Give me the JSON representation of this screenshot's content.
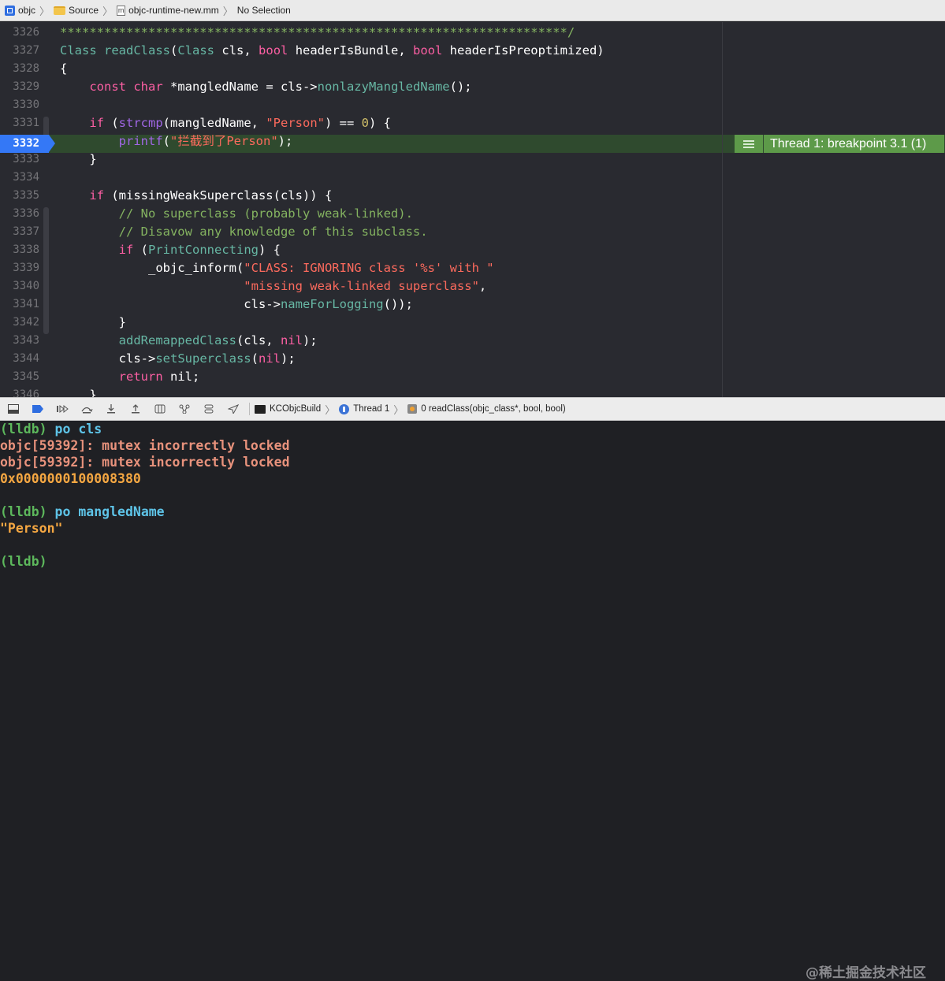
{
  "jumpbar": {
    "project": "objc",
    "folder": "Source",
    "file": "objc-runtime-new.mm",
    "selection": "No Selection",
    "file_icon_letter": "m"
  },
  "editor": {
    "lines": [
      {
        "num": "3326",
        "parts": [
          [
            "cmtg",
            "*********************************************************************/"
          ]
        ]
      },
      {
        "num": "3327",
        "parts": [
          [
            "ty2",
            "Class"
          ],
          [
            "",
            " "
          ],
          [
            "fn",
            "readClass"
          ],
          [
            "",
            "("
          ],
          [
            "ty2",
            "Class"
          ],
          [
            "",
            " cls, "
          ],
          [
            "kw",
            "bool"
          ],
          [
            "",
            " headerIsBundle, "
          ],
          [
            "kw",
            "bool"
          ],
          [
            "",
            " headerIsPreoptimized)"
          ]
        ]
      },
      {
        "num": "3328",
        "parts": [
          [
            "",
            "{"
          ]
        ]
      },
      {
        "num": "3329",
        "parts": [
          [
            "",
            "    "
          ],
          [
            "kw",
            "const"
          ],
          [
            "",
            " "
          ],
          [
            "kw",
            "char"
          ],
          [
            "",
            " *mangledName = cls->"
          ],
          [
            "fn",
            "nonlazyMangledName"
          ],
          [
            "",
            "();"
          ]
        ]
      },
      {
        "num": "3330",
        "parts": [
          [
            "",
            ""
          ]
        ]
      },
      {
        "num": "3331",
        "parts": [
          [
            "",
            "    "
          ],
          [
            "kw",
            "if"
          ],
          [
            "",
            " ("
          ],
          [
            "fnc",
            "strcmp"
          ],
          [
            "",
            "(mangledName, "
          ],
          [
            "str",
            "\"Person\""
          ],
          [
            "",
            ") == "
          ],
          [
            "num",
            "0"
          ],
          [
            "",
            ") {"
          ]
        ]
      },
      {
        "num": "3332",
        "parts": [
          [
            "",
            "        "
          ],
          [
            "fnc",
            "printf"
          ],
          [
            "",
            "("
          ],
          [
            "str",
            "\"拦截到了Person\""
          ],
          [
            "",
            ");"
          ]
        ]
      },
      {
        "num": "3333",
        "parts": [
          [
            "",
            "    }"
          ]
        ]
      },
      {
        "num": "3334",
        "parts": [
          [
            "",
            ""
          ]
        ]
      },
      {
        "num": "3335",
        "parts": [
          [
            "",
            "    "
          ],
          [
            "kw",
            "if"
          ],
          [
            "",
            " (missingWeakSuperclass(cls)) {"
          ]
        ]
      },
      {
        "num": "3336",
        "parts": [
          [
            "",
            "        "
          ],
          [
            "cmtg",
            "// No superclass (probably weak-linked)."
          ]
        ]
      },
      {
        "num": "3337",
        "parts": [
          [
            "",
            "        "
          ],
          [
            "cmtg",
            "// Disavow any knowledge of this subclass."
          ]
        ]
      },
      {
        "num": "3338",
        "parts": [
          [
            "",
            "        "
          ],
          [
            "kw",
            "if"
          ],
          [
            "",
            " ("
          ],
          [
            "fn",
            "PrintConnecting"
          ],
          [
            "",
            ") {"
          ]
        ]
      },
      {
        "num": "3339",
        "parts": [
          [
            "",
            "            _objc_inform("
          ],
          [
            "str",
            "\"CLASS: IGNORING class '%s' with \""
          ]
        ]
      },
      {
        "num": "3340",
        "parts": [
          [
            "",
            "                         "
          ],
          [
            "str",
            "\"missing weak-linked superclass\""
          ],
          [
            "",
            ","
          ]
        ]
      },
      {
        "num": "3341",
        "parts": [
          [
            "",
            "                         cls->"
          ],
          [
            "fn",
            "nameForLogging"
          ],
          [
            "",
            "());"
          ]
        ]
      },
      {
        "num": "3342",
        "parts": [
          [
            "",
            "        }"
          ]
        ]
      },
      {
        "num": "3343",
        "parts": [
          [
            "",
            "        "
          ],
          [
            "fn",
            "addRemappedClass"
          ],
          [
            "",
            "(cls, "
          ],
          [
            "kw",
            "nil"
          ],
          [
            "",
            ");"
          ]
        ]
      },
      {
        "num": "3344",
        "parts": [
          [
            "",
            "        cls->"
          ],
          [
            "fn",
            "setSuperclass"
          ],
          [
            "",
            "("
          ],
          [
            "kw",
            "nil"
          ],
          [
            "",
            ");"
          ]
        ]
      },
      {
        "num": "3345",
        "parts": [
          [
            "",
            "        "
          ],
          [
            "kw",
            "return"
          ],
          [
            "",
            " nil;"
          ]
        ]
      },
      {
        "num": "3346",
        "parts": [
          [
            "",
            "    }"
          ]
        ]
      }
    ],
    "breakpoint_line": "3332",
    "thread_badge": "Thread 1: breakpoint 3.1 (1)"
  },
  "debugbar": {
    "target": "KCObjcBuild",
    "thread": "Thread 1",
    "frame": "0 readClass(objc_class*, bool, bool)"
  },
  "console": {
    "lines": [
      {
        "prompt": "(lldb)",
        "cmd": " po cls"
      },
      {
        "cls": "err",
        "text": "objc[59392]: mutex incorrectly locked"
      },
      {
        "cls": "err",
        "text": "objc[59392]: mutex incorrectly locked"
      },
      {
        "cls": "val",
        "text": "0x0000000100008380"
      },
      {
        "cls": "blank",
        "text": ""
      },
      {
        "prompt": "(lldb)",
        "cmd": " po mangledName"
      },
      {
        "cls": "val",
        "text": "\"Person\""
      },
      {
        "cls": "blank",
        "text": ""
      },
      {
        "prompt": "(lldb)",
        "cmd": ""
      }
    ],
    "watermark": "@稀土掘金技术社区"
  }
}
